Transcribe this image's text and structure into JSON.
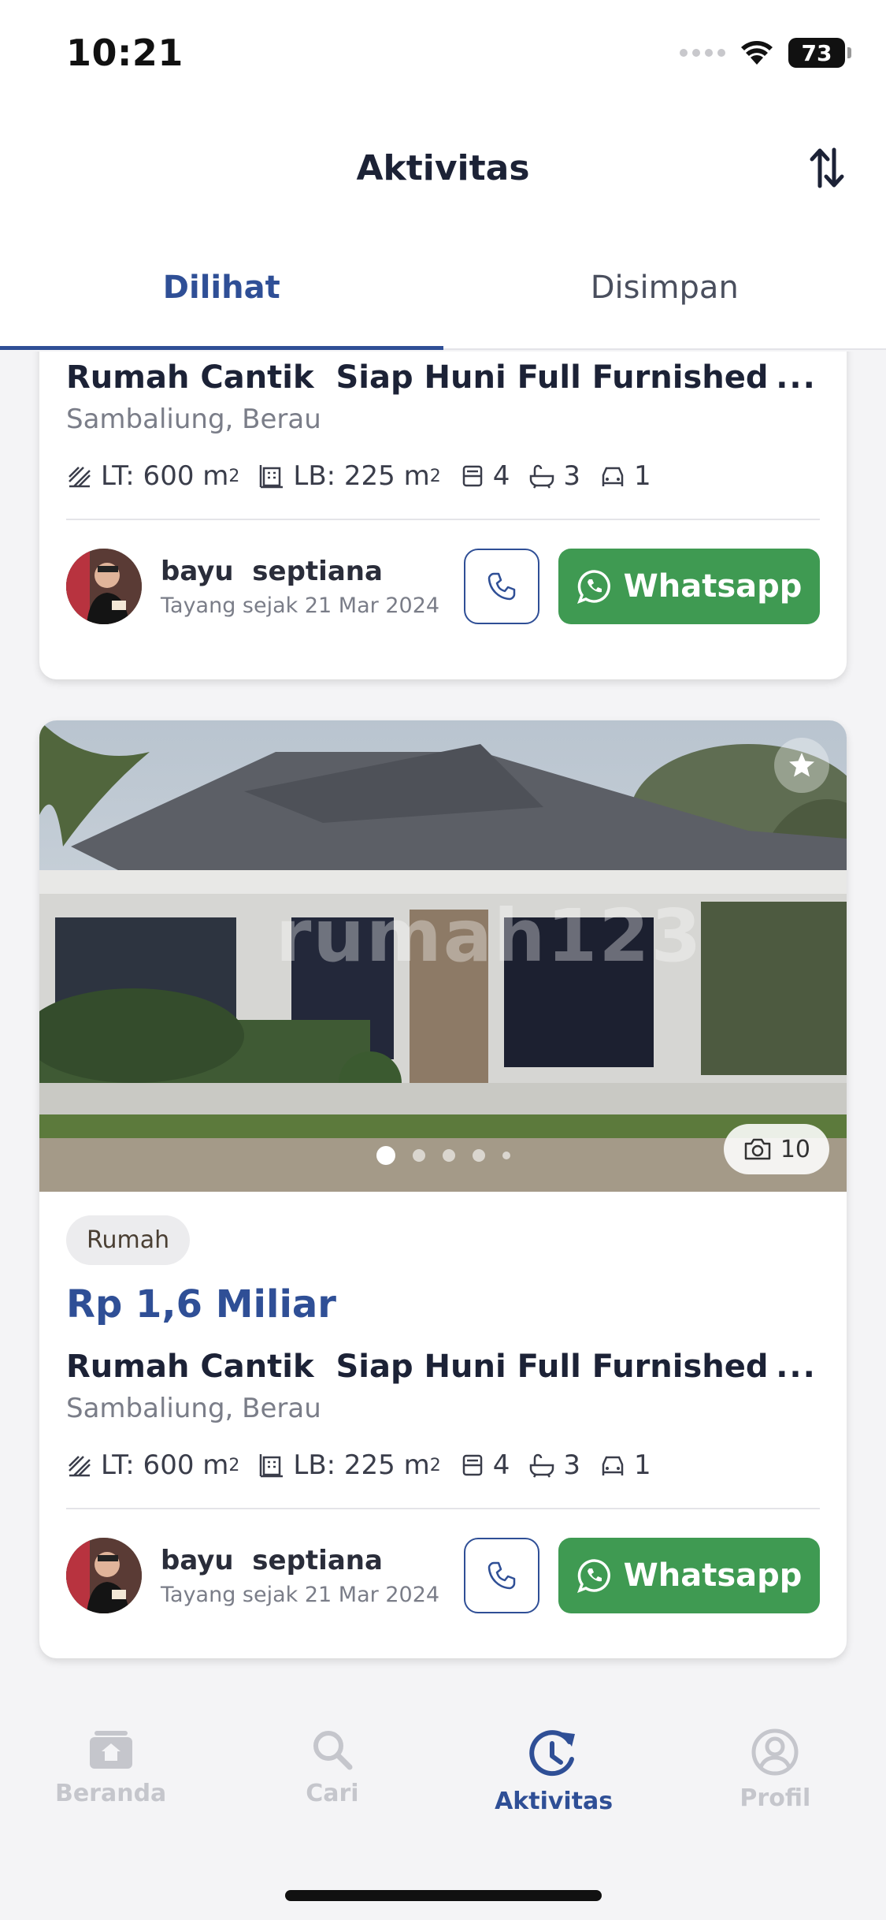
{
  "status_bar": {
    "time": "10:21",
    "battery": "73"
  },
  "header": {
    "title": "Aktivitas"
  },
  "tabs": [
    {
      "label": "Dilihat",
      "active": true
    },
    {
      "label": "Disimpan",
      "active": false
    }
  ],
  "listings": [
    {
      "title": "Rumah Cantik  Siap Huni Full Furnished",
      "location": "Sambaliung, Berau",
      "lt": "LT: 600 m",
      "lb": "LB: 225 m",
      "area_sup": "2",
      "bedrooms": "4",
      "bathrooms": "3",
      "garage": "1",
      "agent_name": "bayu  septiana",
      "agent_since": "Tayang sejak 21 Mar 2024",
      "whatsapp_label": "Whatsapp"
    },
    {
      "type_badge": "Rumah",
      "price": "Rp 1,6 Miliar",
      "photo_count": "10",
      "watermark": "rumah123",
      "title": "Rumah Cantik  Siap Huni Full Furnished",
      "location": "Sambaliung, Berau",
      "lt": "LT: 600 m",
      "lb": "LB: 225 m",
      "area_sup": "2",
      "bedrooms": "4",
      "bathrooms": "3",
      "garage": "1",
      "agent_name": "bayu  septiana",
      "agent_since": "Tayang sejak 21 Mar 2024",
      "whatsapp_label": "Whatsapp"
    }
  ],
  "bottom_nav": [
    {
      "label": "Beranda",
      "icon": "home-icon",
      "active": false
    },
    {
      "label": "Cari",
      "icon": "search-icon",
      "active": false
    },
    {
      "label": "Aktivitas",
      "icon": "activity-history-icon",
      "active": true
    },
    {
      "label": "Profil",
      "icon": "profile-icon",
      "active": false
    }
  ],
  "colors": {
    "primary": "#2f4f96",
    "whatsapp": "#3f9a52",
    "inactive": "#c5c6cc"
  }
}
